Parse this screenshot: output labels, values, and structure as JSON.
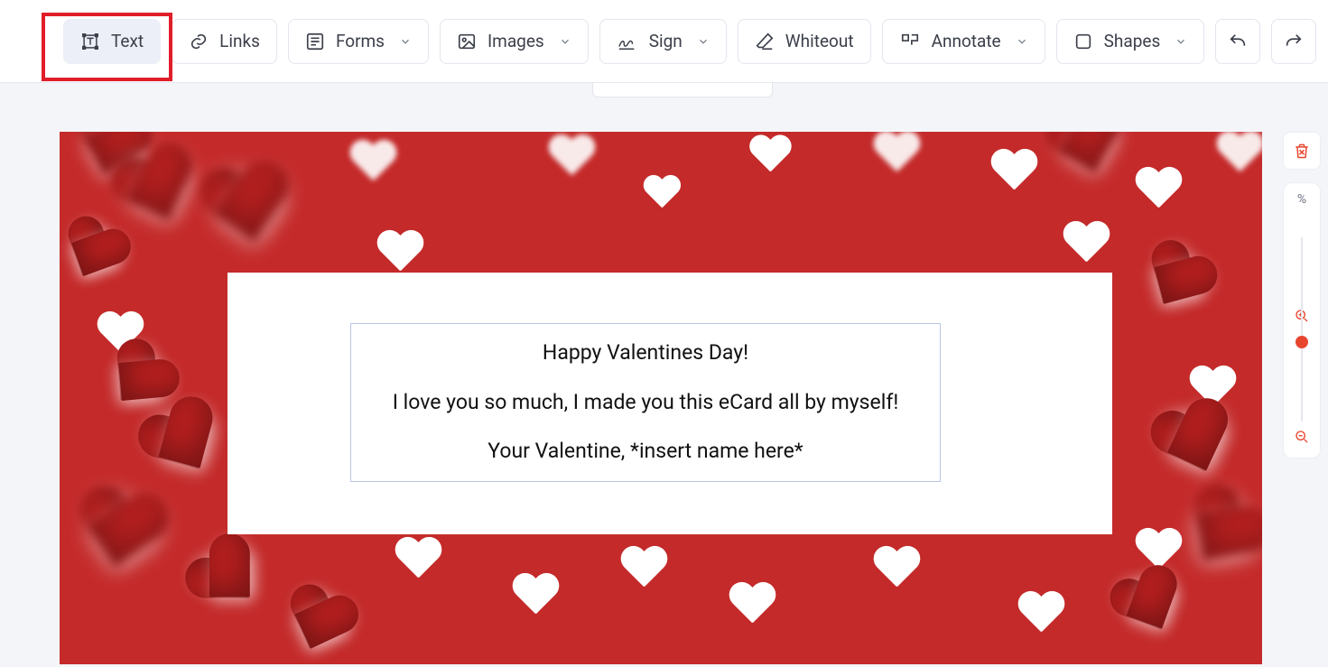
{
  "toolbar": {
    "text_label": "Text",
    "links_label": "Links",
    "forms_label": "Forms",
    "images_label": "Images",
    "sign_label": "Sign",
    "whiteout_label": "Whiteout",
    "annotate_label": "Annotate",
    "shapes_label": "Shapes"
  },
  "zoom": {
    "percent_label": "%"
  },
  "document": {
    "card": {
      "line1": "Happy Valentines Day!",
      "line2": "I love you so much, I made you this eCard all by myself!",
      "line3": "Your Valentine, *insert name here*"
    }
  },
  "colors": {
    "accent_red": "#e8452f",
    "canvas_red": "#c42a2a",
    "highlight": "#e11d2a"
  }
}
